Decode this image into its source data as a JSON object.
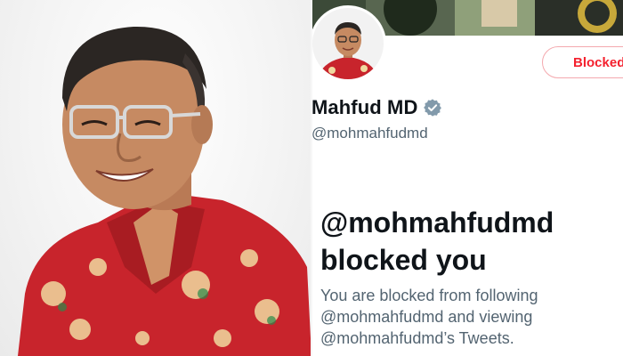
{
  "profile": {
    "name": "Mahfud MD",
    "handle": "@mohmahfudmd",
    "verified": true,
    "action_button": "Blocked"
  },
  "blocked_notice": {
    "title_line1": "@mohmahfudmd",
    "title_line2": "blocked you",
    "desc_line1": "You are blocked from following",
    "desc_line2": "@mohmahfudmd and viewing",
    "desc_line3": "@mohmahfudmd’s Tweets."
  },
  "colors": {
    "accent_blocked": "#f4212e",
    "verified": "#829aab",
    "text_primary": "#0f1419",
    "text_secondary": "#536471"
  }
}
